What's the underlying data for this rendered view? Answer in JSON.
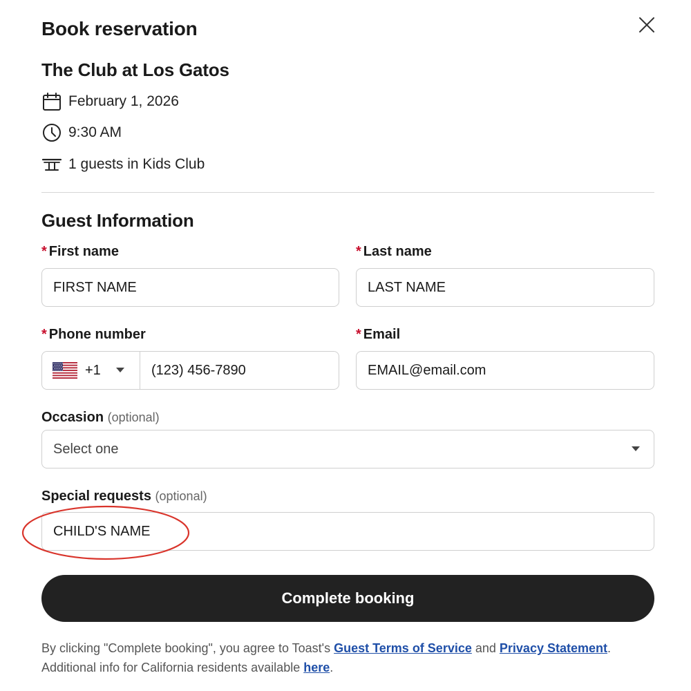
{
  "dialog": {
    "title": "Book reservation",
    "close_icon": "close-icon"
  },
  "reservation": {
    "venue": "The Club at Los Gatos",
    "date": "February 1, 2026",
    "time": "9:30 AM",
    "guests": "1 guests in Kids Club",
    "icons": [
      "calendar-icon",
      "clock-icon",
      "table-icon"
    ]
  },
  "guest_info": {
    "section_title": "Guest Information",
    "required_marker": "*",
    "optional_marker": "(optional)",
    "first_name": {
      "label": "First name",
      "value": "FIRST NAME"
    },
    "last_name": {
      "label": "Last name",
      "value": "LAST NAME"
    },
    "phone": {
      "label": "Phone number",
      "country": "us-flag-icon",
      "dial_code": "+1",
      "value": "(123) 456-7890"
    },
    "email": {
      "label": "Email",
      "value": "EMAIL@email.com"
    },
    "occasion": {
      "label": "Occasion",
      "value": "Select one"
    },
    "special_requests": {
      "label": "Special requests",
      "value": "CHILD'S NAME"
    }
  },
  "annotation": {
    "color": "#d9342b"
  },
  "actions": {
    "submit_label": "Complete booking"
  },
  "legal": {
    "text_1": "By clicking \"Complete booking\", you agree to Toast's ",
    "terms_link": "Guest Terms of Service",
    "text_2": " and ",
    "privacy_link": "Privacy Statement",
    "text_3": ".",
    "text_4": "Additional info for California residents available ",
    "here_link": "here",
    "text_5": "."
  },
  "colors": {
    "required": "#c8102e",
    "button_bg": "#222222",
    "link": "#1f4fa8"
  }
}
